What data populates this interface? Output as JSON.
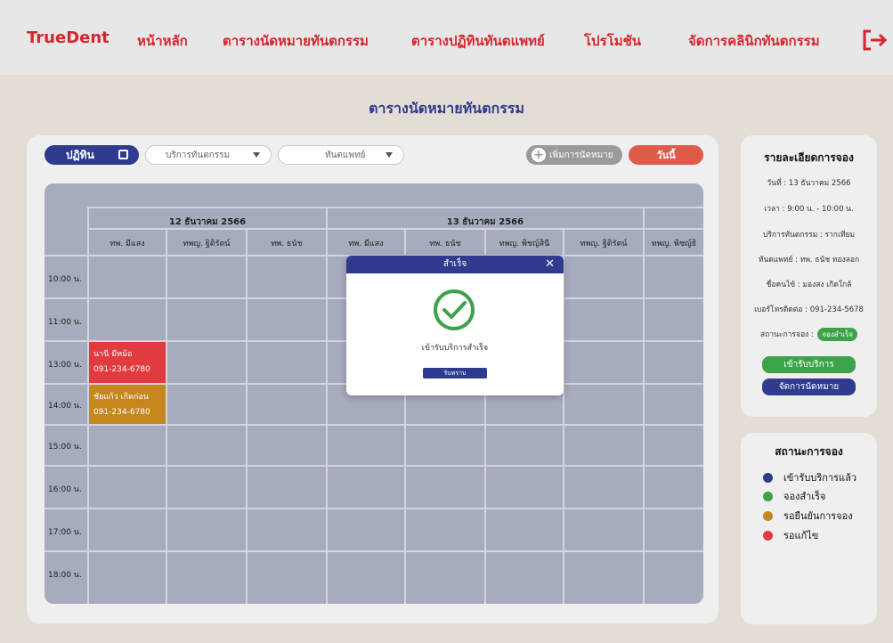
{
  "nav": {
    "brand": "TrueDent",
    "items": [
      "หน้าหลัก",
      "ตารางนัดหมายทันตกรรม",
      "ตารางปฏิทินทันตแพทย์",
      "โปรโมชัน",
      "จัดการคลินิกทันตกรรม"
    ],
    "logout_icon": "logout-icon"
  },
  "page_title": "ตารางนัดหมายทันตกรรม",
  "toolbar": {
    "calendar_label": "ปฏิทิน",
    "service_placeholder": "บริการทันตกรรม",
    "dentist_placeholder": "ทันตแพทย์",
    "add_label": "เพิ่มการนัดหมาย",
    "today_label": "วันนี้"
  },
  "schedule": {
    "dates": [
      "12 ธันวาคม 2566",
      "13 ธันวาคม 2566"
    ],
    "doctors": [
      "ทพ. มีแสง",
      "ทพญ. ฐิติรัตน์",
      "ทพ. ธนัช",
      "ทพ. มีแสง",
      "ทพ. ธนัช",
      "ทพญ. พิชญ์สินี",
      "ทพญ. ฐิติรัตน์",
      "ทพญ. พิชญ์ธิ"
    ],
    "times": [
      "10:00 น.",
      "11:00 น.",
      "13:00 น.",
      "14:00 น.",
      "15:00 น.",
      "16:00 น.",
      "17:00 น.",
      "18:00 น."
    ],
    "appointments": [
      {
        "name": "นานี มีหม้อ",
        "phone": "091-234-6780",
        "status_color": "#e23b3f"
      },
      {
        "name": "ชัยแก้ว เกิดก่อน",
        "phone": "091-234-6780",
        "status_color": "#c7871f"
      }
    ]
  },
  "modal": {
    "title": "สำเร็จ",
    "message": "เข้ารับบริการสำเร็จ",
    "button": "รับทราบ"
  },
  "details": {
    "title": "รายละเอียดการจอง",
    "date": "วันที่ : 13 ธันวาคม 2566",
    "time": "เวลา : 9:00 น. - 10:00 น.",
    "service": "บริการทันตกรรม : รากเทียม",
    "dentist": "ทันตแพทย์ : ทพ. ธนัช ทองลอก",
    "patient": "ชื่อคนไข้ : มองสง เกิดใกล้",
    "phone": "เบอร์โทรติดต่อ : 091-234-5678",
    "status_label": "สถานะการจอง :",
    "status_value": "จองสำเร็จ",
    "btn_checkin": "เข้ารับบริการ",
    "btn_manage": "จัดการนัดหมาย"
  },
  "legend": {
    "title": "สถานะการจอง",
    "items": [
      {
        "label": "เข้ารับบริการแล้ว",
        "color": "#2e3b8e"
      },
      {
        "label": "จองสำเร็จ",
        "color": "#3da34a"
      },
      {
        "label": "รอยืนยันการจอง",
        "color": "#c7871f"
      },
      {
        "label": "รอแก้ไข",
        "color": "#e23b3f"
      }
    ]
  }
}
